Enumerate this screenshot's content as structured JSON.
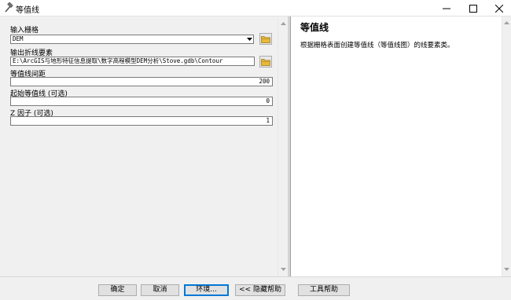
{
  "window": {
    "title": "等值线",
    "icon": "hammer-icon",
    "controls": [
      "minimize-icon",
      "maximize-icon",
      "close-icon"
    ]
  },
  "params": [
    {
      "label": "输入栅格",
      "value": "DEM",
      "kind": "dropdown-browse"
    },
    {
      "label": "输出折线要素",
      "value": "E:\\ArcGIS与地形特征信息提取\\数字高程模型DEM分析\\Stove.gdb\\Contour",
      "kind": "text-browse"
    },
    {
      "label": "等值线间距",
      "value": "200",
      "kind": "number"
    },
    {
      "label": "起始等值线 (可选)",
      "value": "0",
      "kind": "number"
    },
    {
      "label": "Z 因子 (可选)",
      "value": "1",
      "kind": "number"
    }
  ],
  "help": {
    "title": "等值线",
    "body": "根据栅格表面创建等值线（等值线图）的线要素类。"
  },
  "buttons": {
    "ok": "确定",
    "cancel": "取消",
    "environments": "环境...",
    "hide_help": "<< 隐藏帮助",
    "tool_help": "工具帮助"
  },
  "colors": {
    "focus_accent": "#0078d7",
    "folder_icon": "#e8b93a"
  }
}
